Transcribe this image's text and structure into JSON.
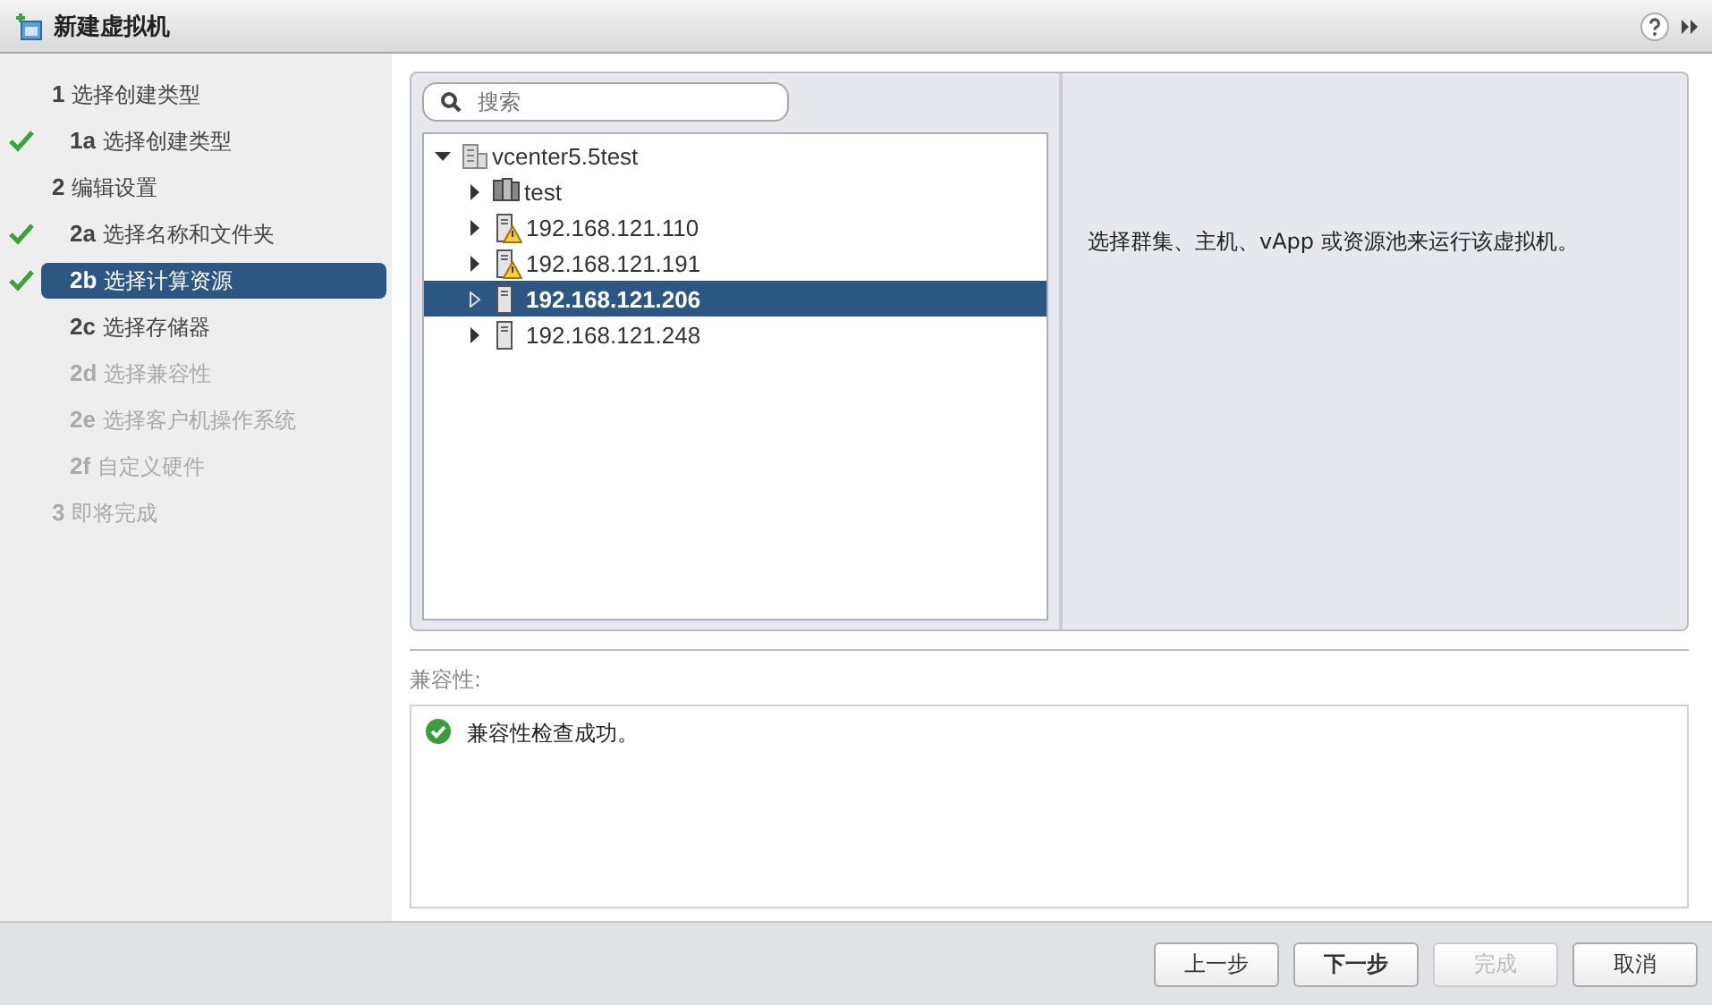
{
  "window": {
    "title": "新建虚拟机"
  },
  "steps": [
    {
      "number": "1",
      "label": "选择创建类型",
      "checked": false,
      "selected": false,
      "disabled": false,
      "children": [
        {
          "number": "1a",
          "label": "选择创建类型",
          "checked": true,
          "selected": false,
          "disabled": false
        }
      ]
    },
    {
      "number": "2",
      "label": "编辑设置",
      "checked": false,
      "selected": false,
      "disabled": false,
      "children": [
        {
          "number": "2a",
          "label": "选择名称和文件夹",
          "checked": true,
          "selected": false,
          "disabled": false
        },
        {
          "number": "2b",
          "label": "选择计算资源",
          "checked": true,
          "selected": true,
          "disabled": false
        },
        {
          "number": "2c",
          "label": "选择存储器",
          "checked": false,
          "selected": false,
          "disabled": false
        },
        {
          "number": "2d",
          "label": "选择兼容性",
          "checked": false,
          "selected": false,
          "disabled": true
        },
        {
          "number": "2e",
          "label": "选择客户机操作系统",
          "checked": false,
          "selected": false,
          "disabled": true
        },
        {
          "number": "2f",
          "label": "自定义硬件",
          "checked": false,
          "selected": false,
          "disabled": true
        }
      ]
    },
    {
      "number": "3",
      "label": "即将完成",
      "checked": false,
      "selected": false,
      "disabled": true
    }
  ],
  "search": {
    "placeholder": "搜索"
  },
  "tree": [
    {
      "label": "vcenter5.5test",
      "kind": "datacenter",
      "expanded": true,
      "selected": false,
      "children": [
        {
          "label": "test",
          "kind": "cluster",
          "expanded": false,
          "selected": false
        },
        {
          "label": "192.168.121.110",
          "kind": "host",
          "expanded": false,
          "selected": false,
          "warning": true
        },
        {
          "label": "192.168.121.191",
          "kind": "host",
          "expanded": false,
          "selected": false,
          "warning": true
        },
        {
          "label": "192.168.121.206",
          "kind": "host",
          "expanded": false,
          "selected": true,
          "warning": false
        },
        {
          "label": "192.168.121.248",
          "kind": "host",
          "expanded": false,
          "selected": false,
          "warning": false
        }
      ]
    }
  ],
  "description": "选择群集、主机、vApp 或资源池来运行该虚拟机。",
  "compatibility": {
    "label": "兼容性:",
    "message": "兼容性检查成功。",
    "ok": true
  },
  "buttons": [
    {
      "label": "上一步",
      "disabled": false,
      "primary": false
    },
    {
      "label": "下一步",
      "disabled": false,
      "primary": true
    },
    {
      "label": "完成",
      "disabled": true,
      "primary": false
    },
    {
      "label": "取消",
      "disabled": false,
      "primary": false
    }
  ]
}
